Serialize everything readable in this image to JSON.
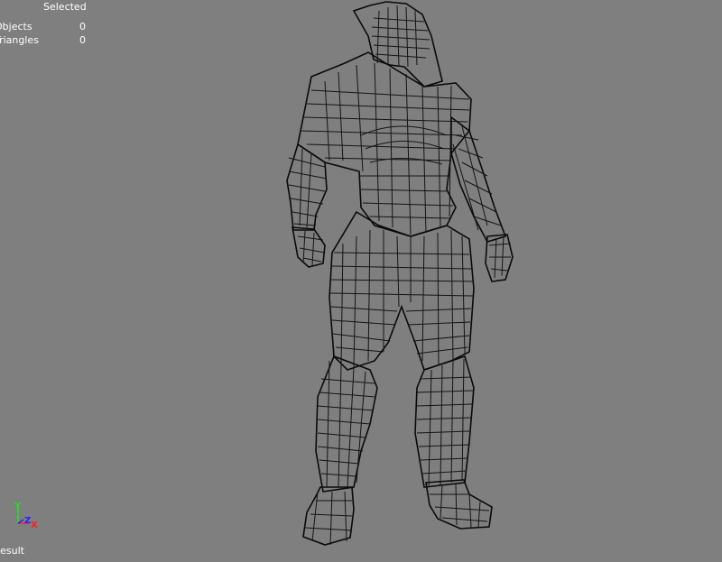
{
  "hud": {
    "column_header": "Selected",
    "rows": [
      {
        "label": "Objects",
        "value": "0"
      },
      {
        "label": "Triangles",
        "value": "0"
      }
    ]
  },
  "axis_gizmo": {
    "y": "Y",
    "z": "Z",
    "x": "X",
    "colors": {
      "x": "#ff2020",
      "y": "#20e020",
      "z": "#2020ff"
    }
  },
  "status_bar": {
    "text": "Result"
  },
  "colors": {
    "background": "#7f7f7f",
    "wireframe": "#141414",
    "text": "#ffffff"
  }
}
